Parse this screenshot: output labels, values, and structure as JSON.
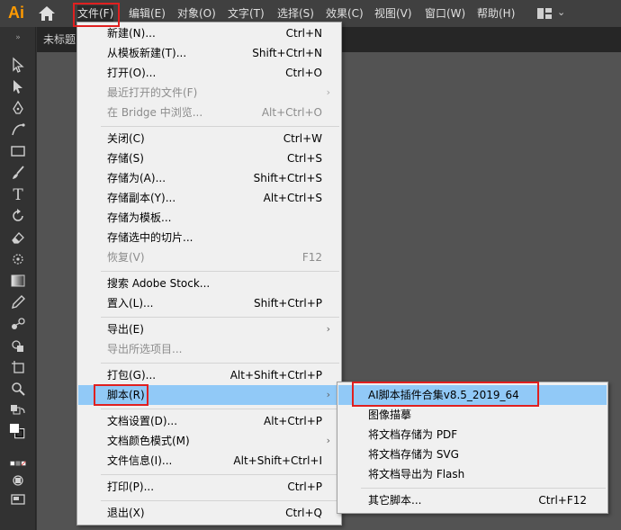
{
  "app": {
    "logo": "Ai"
  },
  "menubar": {
    "items": [
      "文件(F)",
      "编辑(E)",
      "对象(O)",
      "文字(T)",
      "选择(S)",
      "效果(C)",
      "视图(V)",
      "窗口(W)",
      "帮助(H)"
    ]
  },
  "document": {
    "tab_title": "未标题"
  },
  "file_menu": {
    "items": [
      {
        "label": "新建(N)...",
        "shortcut": "Ctrl+N"
      },
      {
        "label": "从模板新建(T)...",
        "shortcut": "Shift+Ctrl+N"
      },
      {
        "label": "打开(O)...",
        "shortcut": "Ctrl+O"
      },
      {
        "label": "最近打开的文件(F)",
        "shortcut": ""
      },
      {
        "label": "在 Bridge 中浏览...",
        "shortcut": "Alt+Ctrl+O"
      },
      {
        "label": "关闭(C)",
        "shortcut": "Ctrl+W"
      },
      {
        "label": "存储(S)",
        "shortcut": "Ctrl+S"
      },
      {
        "label": "存储为(A)...",
        "shortcut": "Shift+Ctrl+S"
      },
      {
        "label": "存储副本(Y)...",
        "shortcut": "Alt+Ctrl+S"
      },
      {
        "label": "存储为模板...",
        "shortcut": ""
      },
      {
        "label": "存储选中的切片...",
        "shortcut": ""
      },
      {
        "label": "恢复(V)",
        "shortcut": "F12"
      },
      {
        "label": "搜索 Adobe Stock...",
        "shortcut": ""
      },
      {
        "label": "置入(L)...",
        "shortcut": "Shift+Ctrl+P"
      },
      {
        "label": "导出(E)",
        "shortcut": ""
      },
      {
        "label": "导出所选项目...",
        "shortcut": ""
      },
      {
        "label": "打包(G)...",
        "shortcut": "Alt+Shift+Ctrl+P"
      },
      {
        "label": "脚本(R)",
        "shortcut": ""
      },
      {
        "label": "文档设置(D)...",
        "shortcut": "Alt+Ctrl+P"
      },
      {
        "label": "文档颜色模式(M)",
        "shortcut": ""
      },
      {
        "label": "文件信息(I)...",
        "shortcut": "Alt+Shift+Ctrl+I"
      },
      {
        "label": "打印(P)...",
        "shortcut": "Ctrl+P"
      },
      {
        "label": "退出(X)",
        "shortcut": "Ctrl+Q"
      }
    ]
  },
  "scripts_submenu": {
    "items": [
      {
        "label": "AI脚本插件合集v8.5_2019_64",
        "shortcut": ""
      },
      {
        "label": "图像描摹",
        "shortcut": ""
      },
      {
        "label": "将文档存储为 PDF",
        "shortcut": ""
      },
      {
        "label": "将文档存储为 SVG",
        "shortcut": ""
      },
      {
        "label": "将文档导出为 Flash",
        "shortcut": ""
      },
      {
        "label": "其它脚本...",
        "shortcut": "Ctrl+F12"
      }
    ]
  },
  "colors": {
    "highlight": "#91c9f7",
    "annotation": "#e02020",
    "logo": "#ff9a00"
  }
}
